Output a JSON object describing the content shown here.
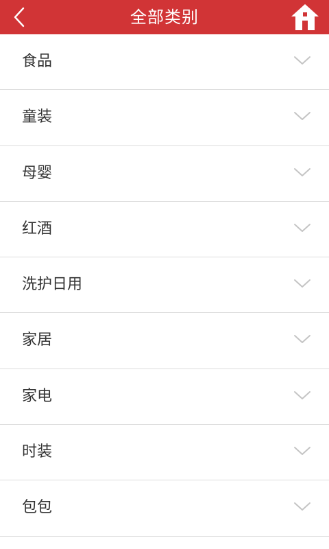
{
  "header": {
    "title": "全部类别",
    "back_icon": "back-chevron-icon",
    "home_icon": "home-icon",
    "bg_color": "#d13436"
  },
  "categories": [
    {
      "label": "食品"
    },
    {
      "label": "童装"
    },
    {
      "label": "母婴"
    },
    {
      "label": "红酒"
    },
    {
      "label": "洗护日用"
    },
    {
      "label": "家居"
    },
    {
      "label": "家电"
    },
    {
      "label": "时装"
    },
    {
      "label": "包包"
    }
  ],
  "row_icon": "chevron-down-icon"
}
